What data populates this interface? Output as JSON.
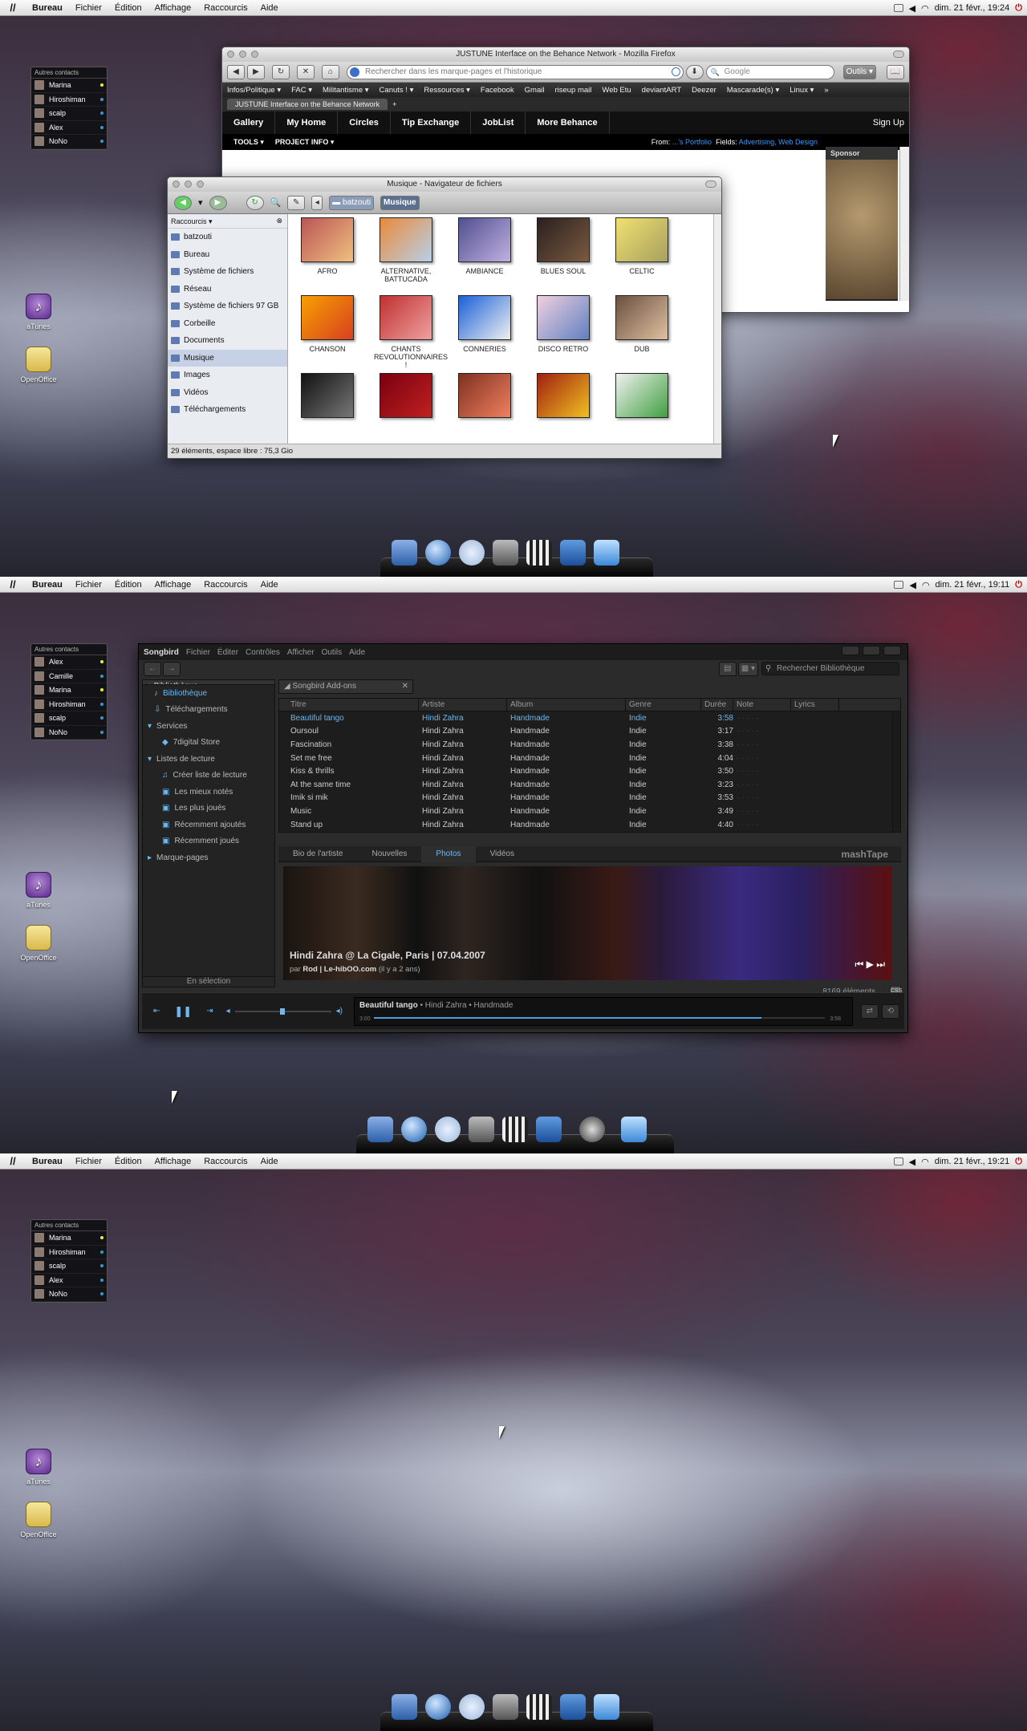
{
  "menubar": {
    "items": [
      "Bureau",
      "Fichier",
      "Édition",
      "Affichage",
      "Raccourcis",
      "Aide"
    ]
  },
  "tray": {
    "dates": [
      "dim. 21 févr., 19:24",
      "dim. 21 févr., 19:11",
      "dim. 21 févr., 19:21"
    ]
  },
  "contacts": {
    "header": "Autres contacts",
    "list1": [
      "Marina",
      "Hiroshiman",
      "scalp",
      "Alex",
      "NoNo"
    ],
    "list2": [
      "Alex",
      "Camille",
      "Marina",
      "Hiroshiman",
      "scalp",
      "NoNo"
    ],
    "list3": [
      "Marina",
      "Hiroshiman",
      "scalp",
      "Alex",
      "NoNo"
    ]
  },
  "desktop_icons": [
    "aTunes",
    "OpenOffice"
  ],
  "firefox": {
    "title": "JUSTUNE Interface on the Behance Network - Mozilla Firefox",
    "url_placeholder": "Rechercher dans les marque-pages et l'historique",
    "search_placeholder": "Google",
    "tools_btn": "Outils",
    "bookmarks": [
      "Infos/Politique ▾",
      "FAC ▾",
      "Militantisme ▾",
      "Canuts ! ▾",
      "Ressources ▾",
      "Facebook",
      "Gmail",
      "riseup mail",
      "Web Etu",
      "deviantART",
      "Deezer",
      "Mascarade(s) ▾",
      "Linux ▾"
    ],
    "tab": "JUSTUNE Interface on the Behance Network",
    "nav": [
      "Gallery",
      "My Home",
      "Circles",
      "Tip Exchange",
      "JobList",
      "More Behance"
    ],
    "signup": "Sign Up",
    "sub": [
      "TOOLS ▾",
      "PROJECT INFO ▾"
    ],
    "from_label": "From:",
    "from_val": "...'s Portfolio",
    "fields_label": "Fields:",
    "fields_val": "Advertising, Web Design",
    "sponsor": "Sponsor"
  },
  "filebrowser": {
    "title": "Musique - Navigateur de fichiers",
    "crumbs": [
      "batzouti",
      "Musique"
    ],
    "side_header": "Raccourcis",
    "side": [
      "batzouti",
      "Bureau",
      "Système de fichiers",
      "Réseau",
      "Système de fichiers 97 GB",
      "Corbeille",
      "Documents",
      "Musique",
      "Images",
      "Vidéos",
      "Téléchargements"
    ],
    "folders": [
      "AFRO",
      "ALTERNATIVE, BATTUCADA",
      "AMBIANCE",
      "BLUES SOUL",
      "CELTIC",
      "CHANSON",
      "CHANTS REVOLUTIONNAIRES !",
      "CONNERIES",
      "DISCO RETRO",
      "DUB"
    ],
    "status": "29 éléments, espace libre : 75,3 Gio"
  },
  "songbird": {
    "menu": [
      "Songbird",
      "Fichier",
      "Éditer",
      "Contrôles",
      "Afficher",
      "Outils",
      "Aide"
    ],
    "search_placeholder": "Rechercher Bibliothèque",
    "lib_tab": "Bibliothèque",
    "addons_tab": "Songbird Add-ons",
    "side": [
      "Bibliothèque",
      "Téléchargements",
      "Services",
      "7digital Store",
      "Listes de lecture",
      "Créer liste de lecture",
      "Les mieux notés",
      "Les plus joués",
      "Récemment ajoutés",
      "Récemment joués",
      "Marque-pages"
    ],
    "side_footer": "En sélection",
    "columns": [
      "Titre",
      "Artiste",
      "Album",
      "Genre",
      "Durée",
      "Note",
      "Lyrics"
    ],
    "tracks": [
      [
        "Beautiful tango",
        "Hindi Zahra",
        "Handmade",
        "Indie",
        "3:58"
      ],
      [
        "Oursoul",
        "Hindi Zahra",
        "Handmade",
        "Indie",
        "3:17"
      ],
      [
        "Fascination",
        "Hindi Zahra",
        "Handmade",
        "Indie",
        "3:38"
      ],
      [
        "Set me free",
        "Hindi Zahra",
        "Handmade",
        "Indie",
        "4:04"
      ],
      [
        "Kiss & thrills",
        "Hindi Zahra",
        "Handmade",
        "Indie",
        "3:50"
      ],
      [
        "At the same time",
        "Hindi Zahra",
        "Handmade",
        "Indie",
        "3:23"
      ],
      [
        "Imik si mik",
        "Hindi Zahra",
        "Handmade",
        "Indie",
        "3:53"
      ],
      [
        "Music",
        "Hindi Zahra",
        "Handmade",
        "Indie",
        "3:49"
      ],
      [
        "Stand up",
        "Hindi Zahra",
        "Handmade",
        "Indie",
        "4:40"
      ]
    ],
    "pane_tabs": [
      "Bio de l'artiste",
      "Nouvelles",
      "Photos",
      "Vidéos"
    ],
    "mashtape": "mashTape",
    "photo_title": "Hindi Zahra @ La Cigale, Paris | 07.04.2007",
    "photo_by": "par",
    "photo_author": "Rod | Le-hibOO.com",
    "photo_age": "(il y a 2 ans)",
    "count": "8169 éléments",
    "now_playing_title": "Beautiful tango",
    "now_playing_rest": "• Hindi Zahra • Handmade",
    "time_start": "3:00",
    "time_end": "3:58",
    "progress": 0.86
  }
}
